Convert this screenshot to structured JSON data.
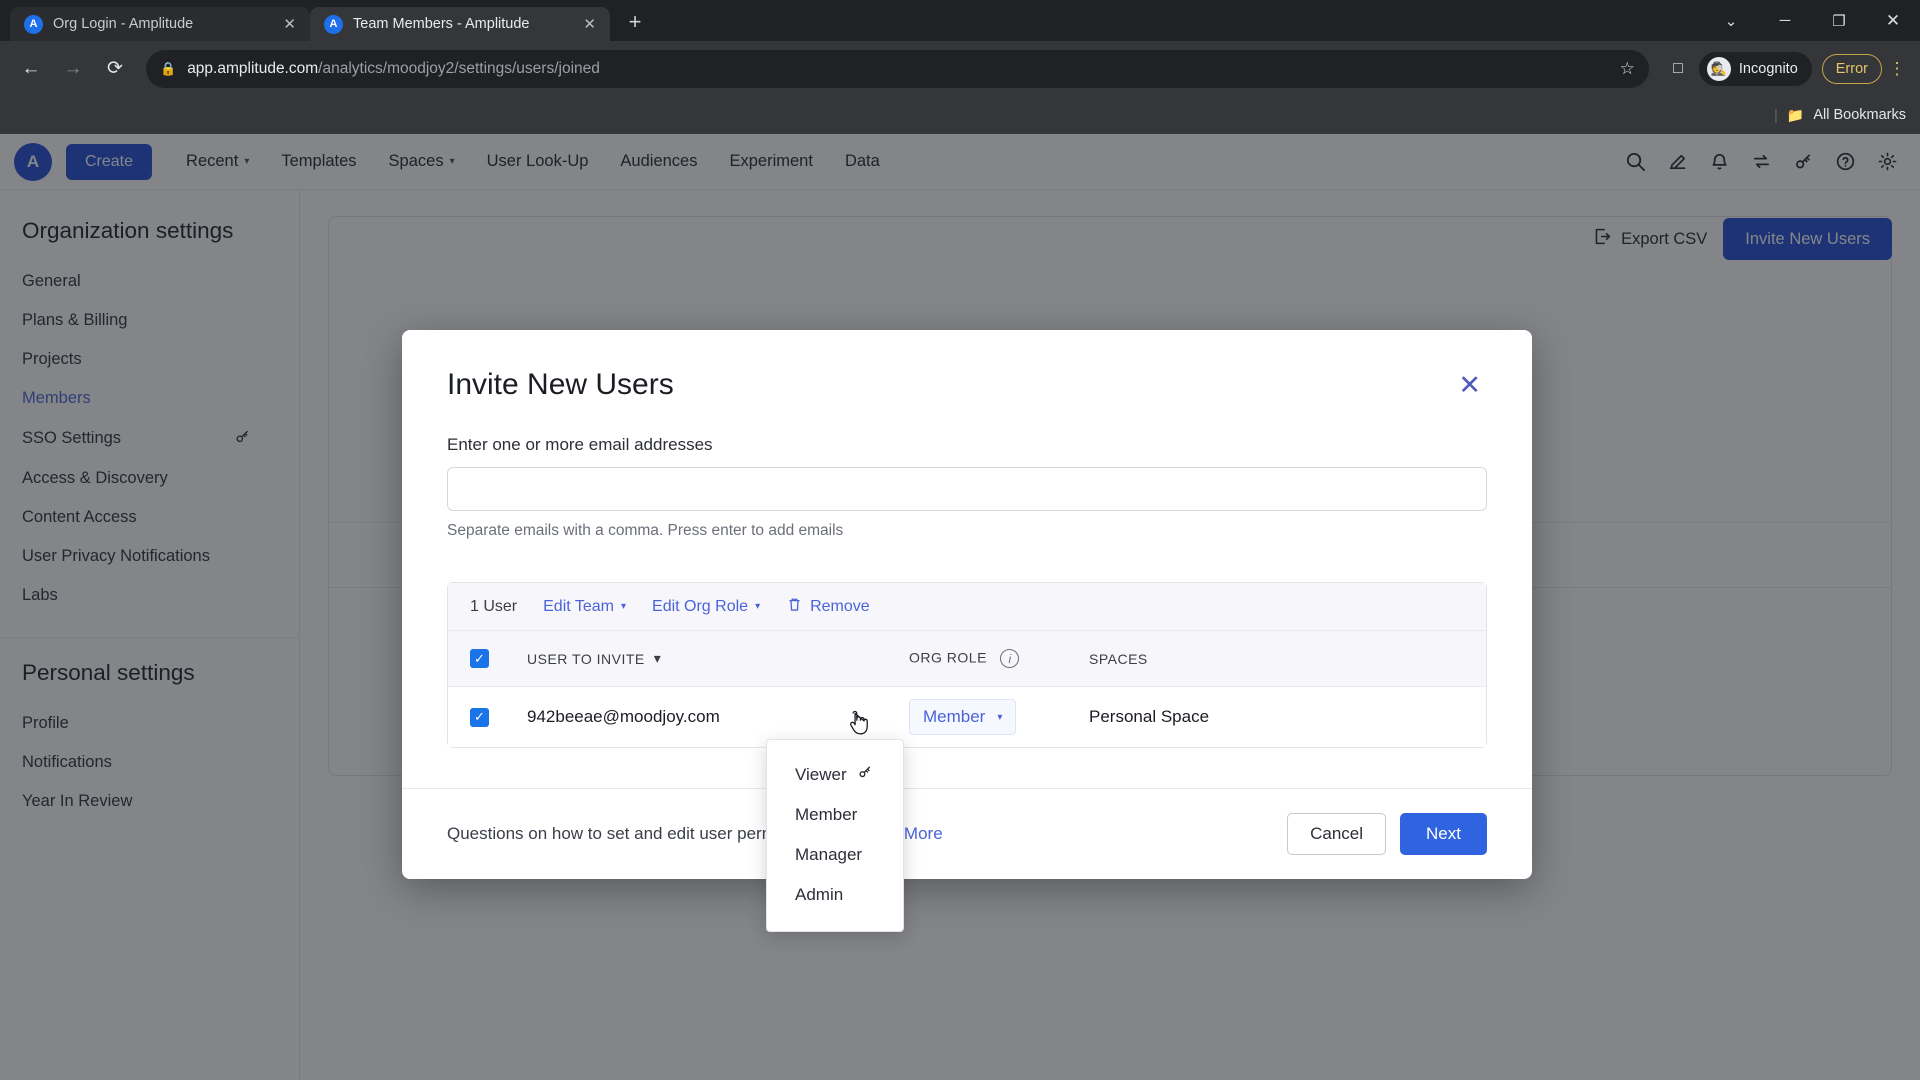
{
  "browser": {
    "tabs": [
      {
        "title": "Org Login - Amplitude",
        "favicon": "amplitude-icon",
        "active": false,
        "close_label": "✕"
      },
      {
        "title": "Team Members - Amplitude",
        "favicon": "amplitude-icon",
        "active": true,
        "close_label": "✕"
      }
    ],
    "new_tab_label": "+",
    "window_controls": {
      "minimize": "─",
      "maximize": "❐",
      "close": "✕",
      "tab_search": "⌄"
    },
    "nav": {
      "back": "←",
      "forward": "→",
      "reload": "⟳"
    },
    "address": {
      "lock_icon": "🔒",
      "url_domain": "app.amplitude.com",
      "url_path": "/analytics/moodjoy2/settings/users/joined",
      "star_icon": "☆"
    },
    "sidepanel_icon": "□",
    "profile": {
      "label": "Incognito",
      "icon": "incognito-icon"
    },
    "error_badge": "Error",
    "menu_icon": "⋮",
    "bookmarks_bar": {
      "separator": "|",
      "folder_icon": "📁",
      "label": "All Bookmarks"
    }
  },
  "appnav": {
    "logo": "A",
    "create_label": "Create",
    "links": [
      {
        "label": "Recent",
        "caret": true
      },
      {
        "label": "Templates",
        "caret": false
      },
      {
        "label": "Spaces",
        "caret": true
      },
      {
        "label": "User Look-Up",
        "caret": false
      },
      {
        "label": "Audiences",
        "caret": false
      },
      {
        "label": "Experiment",
        "caret": false
      },
      {
        "label": "Data",
        "caret": false
      }
    ],
    "icons": [
      {
        "name": "search-icon",
        "glyph": "🔍"
      },
      {
        "name": "feedback-icon",
        "glyph": "✍"
      },
      {
        "name": "notifications-icon",
        "glyph": "🔔"
      },
      {
        "name": "integrations-icon",
        "glyph": "⇄"
      },
      {
        "name": "sparkle-key-icon",
        "glyph": "⚷"
      },
      {
        "name": "help-icon",
        "glyph": "?"
      },
      {
        "name": "settings-gear-icon",
        "glyph": "⚙"
      }
    ]
  },
  "sidebar": {
    "org_heading": "Organization settings",
    "org_items": [
      {
        "label": "General",
        "active": false,
        "badge": ""
      },
      {
        "label": "Plans & Billing",
        "active": false,
        "badge": ""
      },
      {
        "label": "Projects",
        "active": false,
        "badge": ""
      },
      {
        "label": "Members",
        "active": true,
        "badge": ""
      },
      {
        "label": "SSO Settings",
        "active": false,
        "badge": "⚷"
      },
      {
        "label": "Access & Discovery",
        "active": false,
        "badge": ""
      },
      {
        "label": "Content Access",
        "active": false,
        "badge": ""
      },
      {
        "label": "User Privacy Notifications",
        "active": false,
        "badge": ""
      },
      {
        "label": "Labs",
        "active": false,
        "badge": ""
      }
    ],
    "personal_heading": "Personal settings",
    "personal_items": [
      {
        "label": "Profile",
        "active": false,
        "badge": ""
      },
      {
        "label": "Notifications",
        "active": false,
        "badge": ""
      },
      {
        "label": "Year In Review",
        "active": false,
        "badge": ""
      }
    ]
  },
  "background_page": {
    "export_label": "Export CSV",
    "export_icon": "export-icon",
    "invite_label": "Invite New Users"
  },
  "modal": {
    "title": "Invite New Users",
    "close_label": "✕",
    "email_label": "Enter one or more email addresses",
    "email_value": "",
    "email_placeholder": "",
    "email_hint": "Separate emails with a comma. Press enter to add emails",
    "toolbar": {
      "count": "1 User",
      "edit_team": "Edit Team",
      "edit_org_role": "Edit Org Role",
      "remove": "Remove",
      "remove_icon": "trash-icon",
      "caret": "⌄"
    },
    "table": {
      "headers": {
        "user": "USER TO INVITE",
        "user_sort_caret": "▾",
        "role": "ORG ROLE",
        "role_info_icon": "info-icon",
        "spaces": "SPACES"
      },
      "header_checked": true,
      "rows": [
        {
          "checked": true,
          "email": "942beeae@moodjoy.com",
          "role": "Member",
          "role_caret": "⌄",
          "spaces": "Personal Space"
        }
      ]
    },
    "role_menu": {
      "open": true,
      "options": [
        {
          "label": "Viewer",
          "badge": "⚷"
        },
        {
          "label": "Member",
          "badge": ""
        },
        {
          "label": "Manager",
          "badge": ""
        },
        {
          "label": "Admin",
          "badge": ""
        }
      ]
    },
    "footer": {
      "question": "Questions on how to set and edit user permissions?",
      "learn_more": "Learn More",
      "cancel": "Cancel",
      "next": "Next"
    }
  },
  "colors": {
    "brand_blue": "#1f4bd8",
    "link_blue": "#4b63d8",
    "primary_action": "#2f63e0",
    "checkbox_blue": "#1a73e8",
    "error_amber": "#e3c56a"
  }
}
